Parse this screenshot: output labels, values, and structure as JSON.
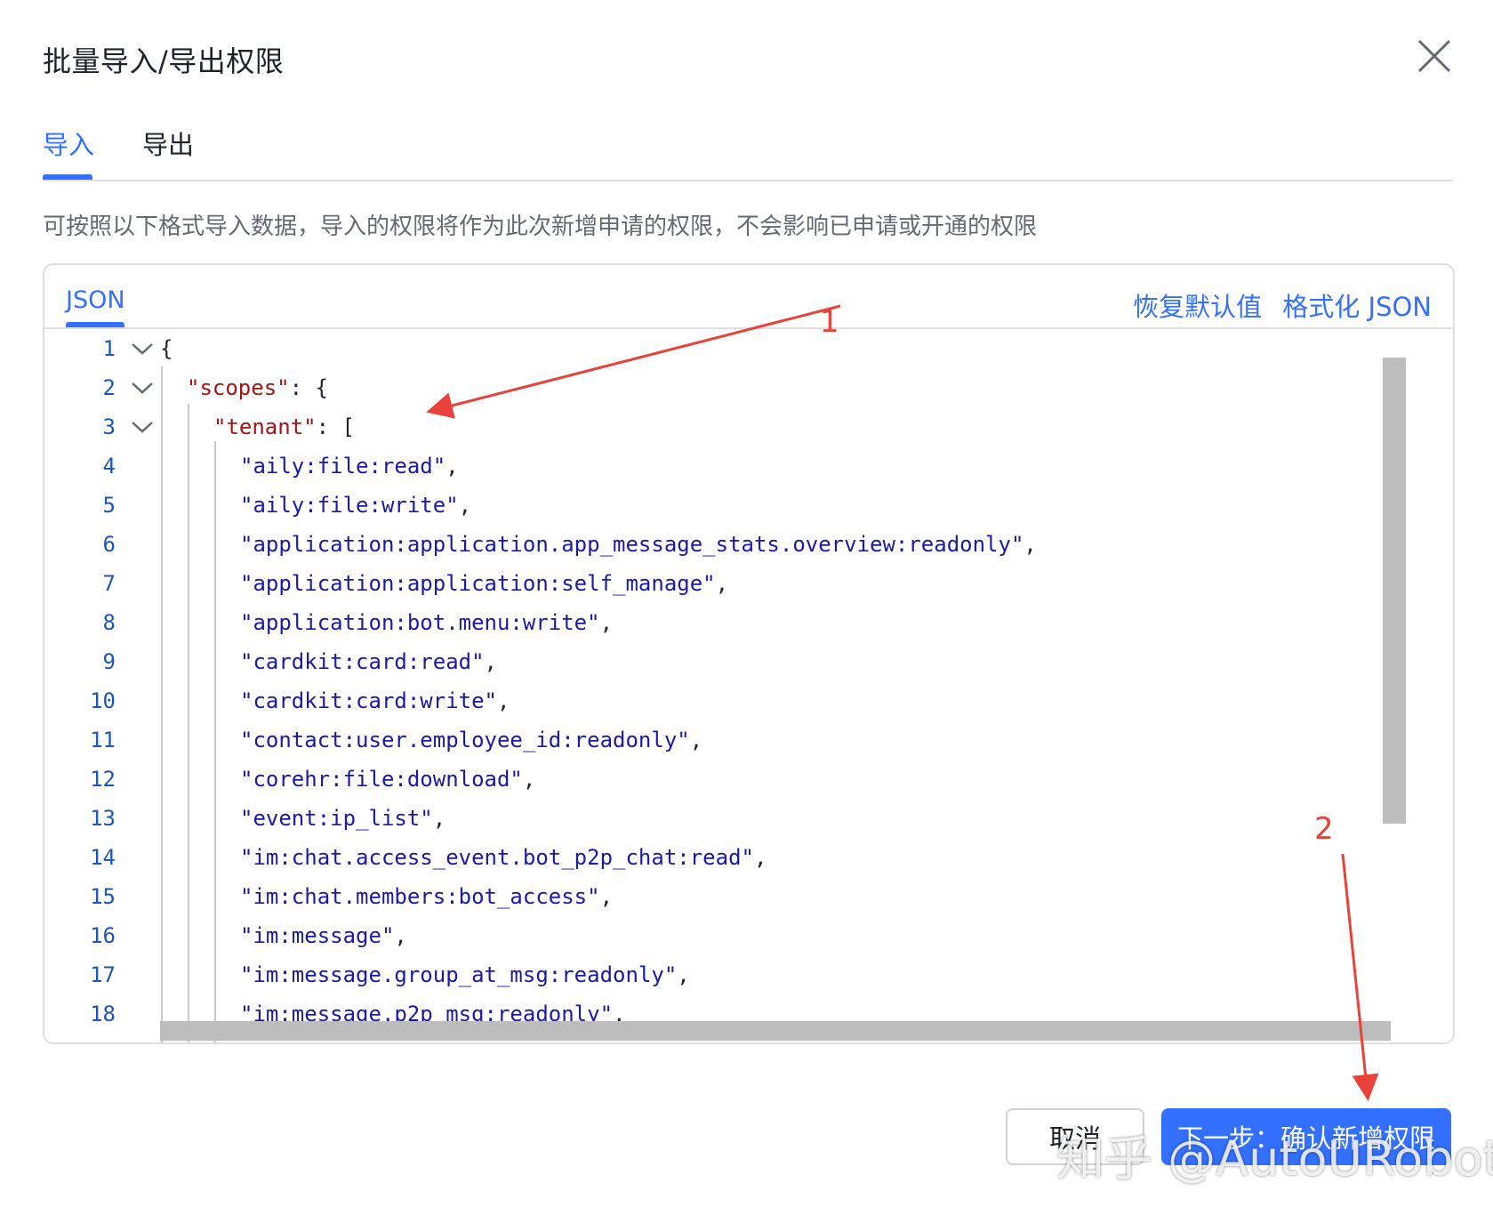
{
  "dialog": {
    "title": "批量导入/导出权限",
    "close_icon": "close-icon"
  },
  "tabs": [
    {
      "label": "导入",
      "active": true
    },
    {
      "label": "导出",
      "active": false
    }
  ],
  "description": "可按照以下格式导入数据，导入的权限将作为此次新增申请的权限，不会影响已申请或开通的权限",
  "editor": {
    "tab_label": "JSON",
    "actions": {
      "restore_default": "恢复默认值",
      "format_json": "格式化 JSON"
    },
    "lines": [
      {
        "num": "1",
        "text": "{"
      },
      {
        "num": "2",
        "key": "\"scopes\"",
        "rest": ": {"
      },
      {
        "num": "3",
        "key": "\"tenant\"",
        "rest": ": ["
      },
      {
        "num": "4",
        "value": "\"aily:file:read\"",
        "rest": ","
      },
      {
        "num": "5",
        "value": "\"aily:file:write\"",
        "rest": ","
      },
      {
        "num": "6",
        "value": "\"application:application.app_message_stats.overview:readonly\"",
        "rest": ","
      },
      {
        "num": "7",
        "value": "\"application:application:self_manage\"",
        "rest": ","
      },
      {
        "num": "8",
        "value": "\"application:bot.menu:write\"",
        "rest": ","
      },
      {
        "num": "9",
        "value": "\"cardkit:card:read\"",
        "rest": ","
      },
      {
        "num": "10",
        "value": "\"cardkit:card:write\"",
        "rest": ","
      },
      {
        "num": "11",
        "value": "\"contact:user.employee_id:readonly\"",
        "rest": ","
      },
      {
        "num": "12",
        "value": "\"corehr:file:download\"",
        "rest": ","
      },
      {
        "num": "13",
        "value": "\"event:ip_list\"",
        "rest": ","
      },
      {
        "num": "14",
        "value": "\"im:chat.access_event.bot_p2p_chat:read\"",
        "rest": ","
      },
      {
        "num": "15",
        "value": "\"im:chat.members:bot_access\"",
        "rest": ","
      },
      {
        "num": "16",
        "value": "\"im:message\"",
        "rest": ","
      },
      {
        "num": "17",
        "value": "\"im:message.group_at_msg:readonly\"",
        "rest": ","
      },
      {
        "num": "18",
        "value": "\"im:message.p2p_msg:readonly\"",
        "rest": ","
      }
    ]
  },
  "footer": {
    "cancel_label": "取消",
    "next_label": "下一步：确认新增权限"
  },
  "annotations": {
    "arrow_1_label": "1",
    "arrow_2_label": "2",
    "color": "#e8423a"
  },
  "watermark": "知乎 @AutoURobot",
  "colors": {
    "accent": "#3370ff",
    "json_key": "#a31515",
    "json_string": "#1a1aa6",
    "line_number": "#1b57b8"
  }
}
